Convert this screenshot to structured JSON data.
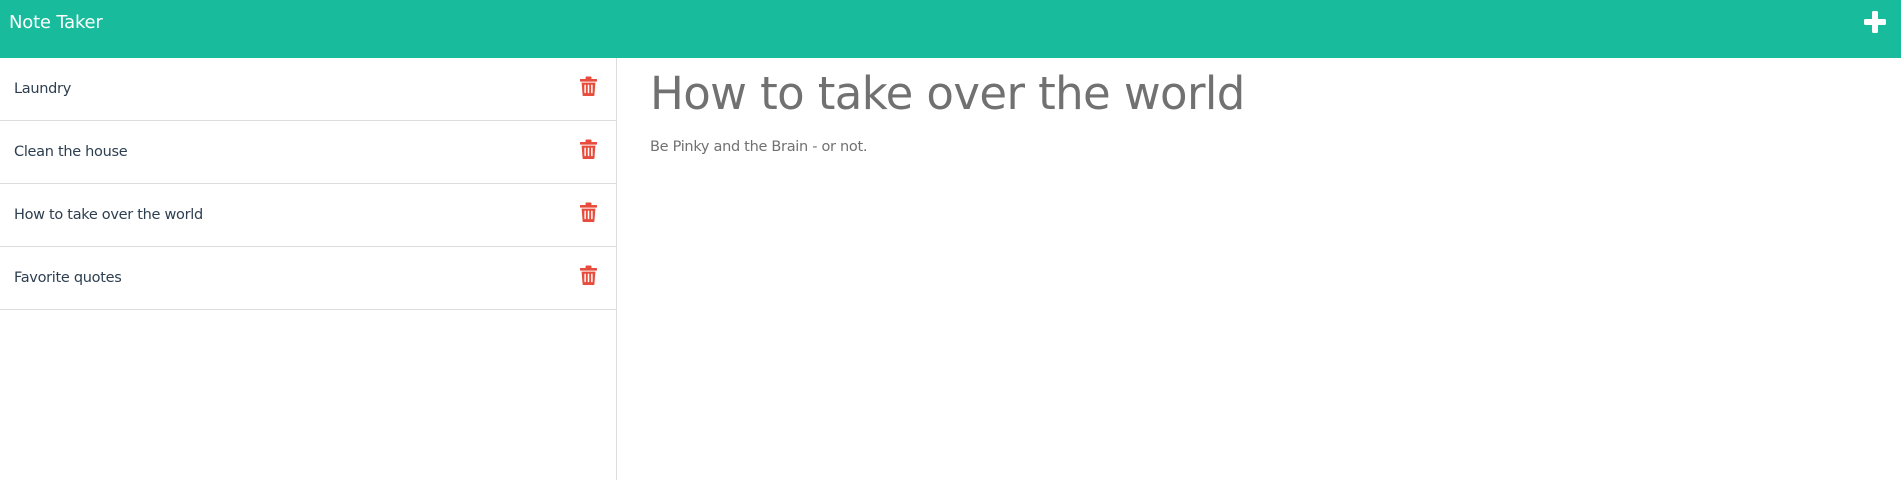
{
  "app": {
    "brand": "Note Taker",
    "new_note_icon": "plus-icon",
    "colors": {
      "navbar": "#18bc9c",
      "delete": "#e74c3c",
      "note_text": "#717171"
    }
  },
  "sidebar": {
    "delete_icon": "trash-icon",
    "items": [
      {
        "title": "Laundry"
      },
      {
        "title": "Clean the house"
      },
      {
        "title": "How to take over the world"
      },
      {
        "title": "Favorite quotes"
      }
    ]
  },
  "editor": {
    "title": "How to take over the world",
    "text": "Be Pinky and the Brain - or not."
  }
}
